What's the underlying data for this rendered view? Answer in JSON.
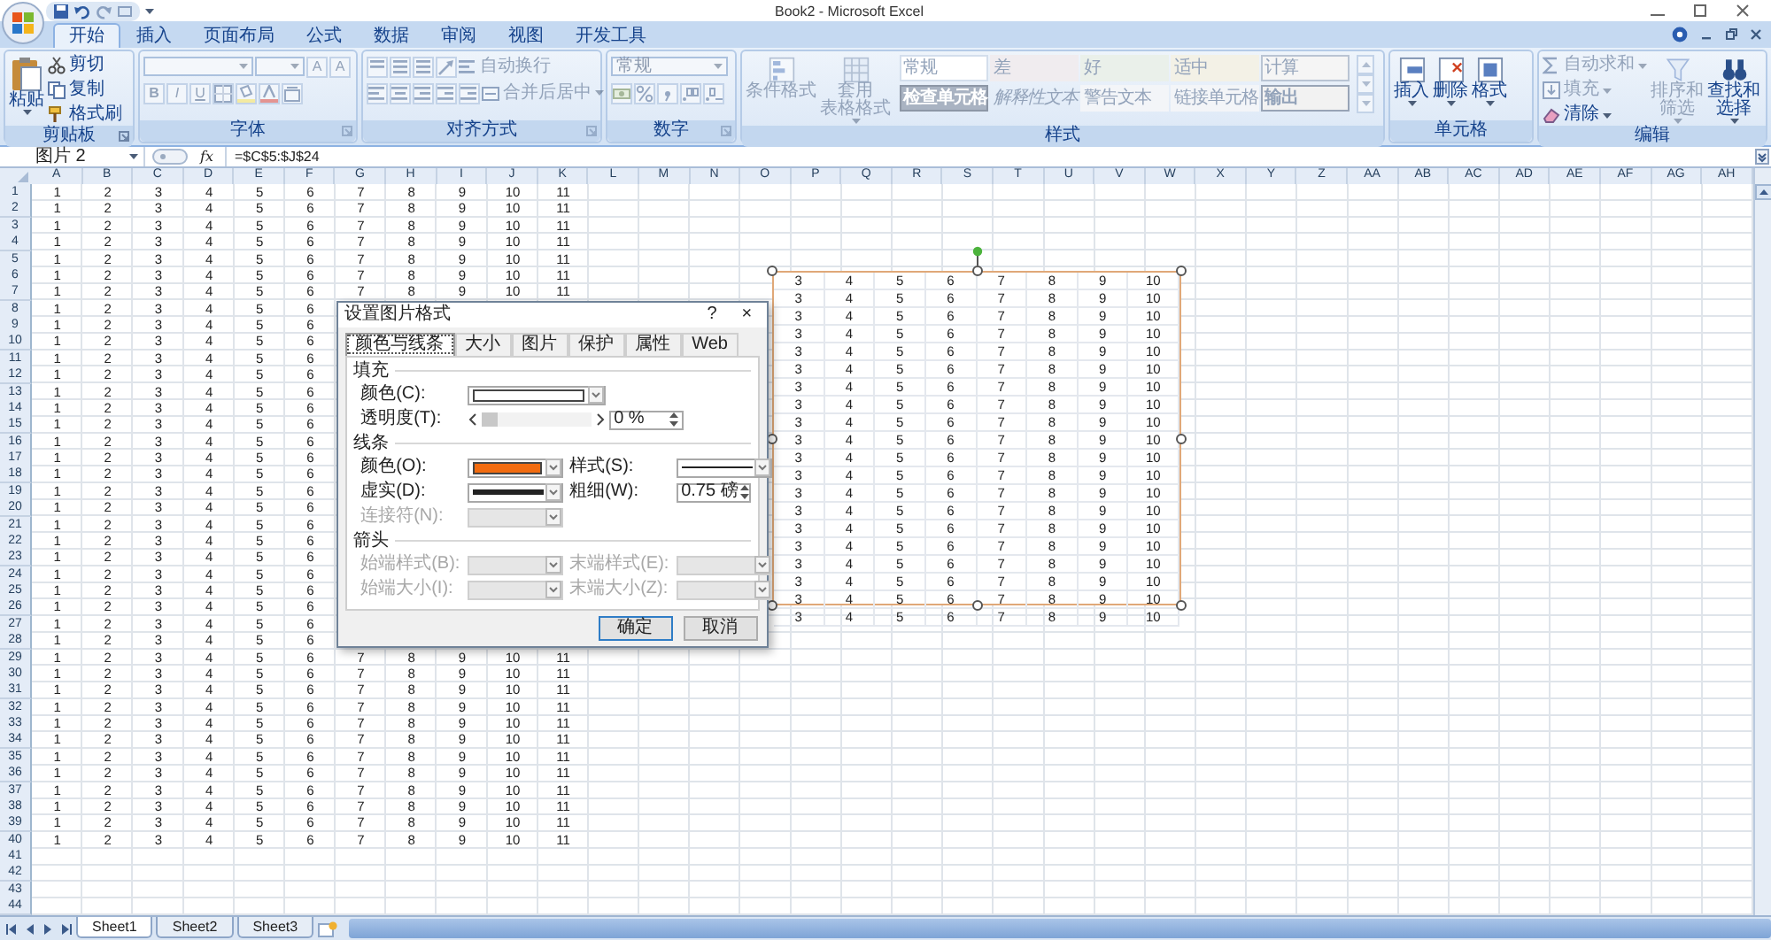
{
  "window": {
    "title": "Book2 - Microsoft Excel"
  },
  "ribbon_tabs": [
    {
      "label": "开始",
      "selected": true
    },
    {
      "label": "插入",
      "selected": false
    },
    {
      "label": "页面布局",
      "selected": false
    },
    {
      "label": "公式",
      "selected": false
    },
    {
      "label": "数据",
      "selected": false
    },
    {
      "label": "审阅",
      "selected": false
    },
    {
      "label": "视图",
      "selected": false
    },
    {
      "label": "开发工具",
      "selected": false
    }
  ],
  "ribbon": {
    "groups": [
      {
        "kind": "clipboard",
        "label": "剪贴板",
        "paste": "粘贴",
        "actions": [
          "剪切",
          "复制",
          "格式刷"
        ]
      },
      {
        "kind": "font",
        "label": "字体",
        "disabled": true,
        "size_buttons": [
          "A",
          "A"
        ],
        "format_buttons": [
          "B",
          "I",
          "U"
        ]
      },
      {
        "kind": "alignment",
        "label": "对齐方式",
        "disabled": true,
        "wrap": "自动换行",
        "merge": "合并后居中"
      },
      {
        "kind": "number",
        "label": "数字",
        "disabled": true,
        "format": "常规"
      },
      {
        "kind": "styles",
        "label": "样式",
        "disabled": true,
        "buttons": [
          {
            "lines": [
              "条件格式"
            ]
          },
          {
            "lines": [
              "套用",
              "表格格式"
            ]
          }
        ],
        "cells": [
          {
            "text": "常规",
            "kind": "normal"
          },
          {
            "text": "差",
            "kind": "bad"
          },
          {
            "text": "好",
            "kind": "good"
          },
          {
            "text": "适中",
            "kind": "neutral"
          },
          {
            "text": "计算",
            "kind": "calc"
          },
          {
            "text": "检查单元格",
            "kind": "check"
          },
          {
            "text": "解释性文本",
            "kind": "explanatory"
          },
          {
            "text": "警告文本",
            "kind": "warning"
          },
          {
            "text": "链接单元格",
            "kind": "linked"
          },
          {
            "text": "输出",
            "kind": "output"
          }
        ]
      },
      {
        "kind": "cells",
        "label": "单元格",
        "buttons": [
          "插入",
          "删除",
          "格式"
        ]
      },
      {
        "kind": "editing",
        "label": "编辑",
        "actions": [
          {
            "label": "自动求和",
            "disabled": true
          },
          {
            "label": "填充",
            "disabled": true
          },
          {
            "label": "清除",
            "disabled": false
          }
        ],
        "buttons": [
          {
            "lines": [
              "排序和",
              "筛选"
            ],
            "disabled": true
          },
          {
            "lines": [
              "查找和",
              "选择"
            ],
            "disabled": false
          }
        ]
      }
    ]
  },
  "formula_bar": {
    "name_box": "图片 2",
    "function_label": "fx",
    "formula": "=$C$5:$J$24"
  },
  "sheet": {
    "columns": [
      "A",
      "B",
      "C",
      "D",
      "E",
      "F",
      "G",
      "H",
      "I",
      "J",
      "K",
      "L",
      "M",
      "N",
      "O",
      "P",
      "Q",
      "R",
      "S",
      "T",
      "U",
      "V",
      "W",
      "X",
      "Y",
      "Z",
      "AA",
      "AB",
      "AC",
      "AD",
      "AE",
      "AF",
      "AG",
      "AH"
    ],
    "rows": [
      {
        "header": "1",
        "cells": [
          "1",
          "2",
          "3",
          "4",
          "5",
          "6",
          "7",
          "8",
          "9",
          "10",
          "11"
        ]
      },
      {
        "header": "2",
        "cells": [
          "1",
          "2",
          "3",
          "4",
          "5",
          "6",
          "7",
          "8",
          "9",
          "10",
          "11"
        ]
      },
      {
        "header": "3",
        "cells": [
          "1",
          "2",
          "3",
          "4",
          "5",
          "6",
          "7",
          "8",
          "9",
          "10",
          "11"
        ]
      },
      {
        "header": "4",
        "cells": [
          "1",
          "2",
          "3",
          "4",
          "5",
          "6",
          "7",
          "8",
          "9",
          "10",
          "11"
        ]
      },
      {
        "header": "5",
        "cells": [
          "1",
          "2",
          "3",
          "4",
          "5",
          "6",
          "7",
          "8",
          "9",
          "10",
          "11"
        ]
      },
      {
        "header": "6",
        "cells": [
          "1",
          "2",
          "3",
          "4",
          "5",
          "6",
          "7",
          "8",
          "9",
          "10",
          "11"
        ]
      },
      {
        "header": "7",
        "cells": [
          "1",
          "2",
          "3",
          "4",
          "5",
          "6",
          "7",
          "8",
          "9",
          "10",
          "11"
        ]
      },
      {
        "header": "8",
        "cells": [
          "1",
          "2",
          "3",
          "4",
          "5",
          "6"
        ]
      },
      {
        "header": "9",
        "cells": [
          "1",
          "2",
          "3",
          "4",
          "5",
          "6"
        ]
      },
      {
        "header": "10",
        "cells": [
          "1",
          "2",
          "3",
          "4",
          "5",
          "6"
        ]
      },
      {
        "header": "11",
        "cells": [
          "1",
          "2",
          "3",
          "4",
          "5",
          "6"
        ]
      },
      {
        "header": "12",
        "cells": [
          "1",
          "2",
          "3",
          "4",
          "5",
          "6"
        ]
      },
      {
        "header": "13",
        "cells": [
          "1",
          "2",
          "3",
          "4",
          "5",
          "6"
        ]
      },
      {
        "header": "14",
        "cells": [
          "1",
          "2",
          "3",
          "4",
          "5",
          "6"
        ]
      },
      {
        "header": "15",
        "cells": [
          "1",
          "2",
          "3",
          "4",
          "5",
          "6"
        ]
      },
      {
        "header": "16",
        "cells": [
          "1",
          "2",
          "3",
          "4",
          "5",
          "6"
        ]
      },
      {
        "header": "17",
        "cells": [
          "1",
          "2",
          "3",
          "4",
          "5",
          "6"
        ]
      },
      {
        "header": "18",
        "cells": [
          "1",
          "2",
          "3",
          "4",
          "5",
          "6"
        ]
      },
      {
        "header": "19",
        "cells": [
          "1",
          "2",
          "3",
          "4",
          "5",
          "6"
        ]
      },
      {
        "header": "20",
        "cells": [
          "1",
          "2",
          "3",
          "4",
          "5",
          "6"
        ]
      },
      {
        "header": "21",
        "cells": [
          "1",
          "2",
          "3",
          "4",
          "5",
          "6"
        ]
      },
      {
        "header": "22",
        "cells": [
          "1",
          "2",
          "3",
          "4",
          "5",
          "6"
        ]
      },
      {
        "header": "23",
        "cells": [
          "1",
          "2",
          "3",
          "4",
          "5",
          "6"
        ]
      },
      {
        "header": "24",
        "cells": [
          "1",
          "2",
          "3",
          "4",
          "5",
          "6"
        ]
      },
      {
        "header": "25",
        "cells": [
          "1",
          "2",
          "3",
          "4",
          "5",
          "6"
        ]
      },
      {
        "header": "26",
        "cells": [
          "1",
          "2",
          "3",
          "4",
          "5",
          "6"
        ]
      },
      {
        "header": "27",
        "cells": [
          "1",
          "2",
          "3",
          "4",
          "5",
          "6"
        ]
      },
      {
        "header": "28",
        "cells": [
          "1",
          "2",
          "3",
          "4",
          "5",
          "6"
        ]
      },
      {
        "header": "29",
        "cells": [
          "1",
          "2",
          "3",
          "4",
          "5",
          "6",
          "7",
          "8",
          "9",
          "10",
          "11"
        ]
      },
      {
        "header": "30",
        "cells": [
          "1",
          "2",
          "3",
          "4",
          "5",
          "6",
          "7",
          "8",
          "9",
          "10",
          "11"
        ]
      },
      {
        "header": "31",
        "cells": [
          "1",
          "2",
          "3",
          "4",
          "5",
          "6",
          "7",
          "8",
          "9",
          "10",
          "11"
        ]
      },
      {
        "header": "32",
        "cells": [
          "1",
          "2",
          "3",
          "4",
          "5",
          "6",
          "7",
          "8",
          "9",
          "10",
          "11"
        ]
      },
      {
        "header": "33",
        "cells": [
          "1",
          "2",
          "3",
          "4",
          "5",
          "6",
          "7",
          "8",
          "9",
          "10",
          "11"
        ]
      },
      {
        "header": "34",
        "cells": [
          "1",
          "2",
          "3",
          "4",
          "5",
          "6",
          "7",
          "8",
          "9",
          "10",
          "11"
        ]
      },
      {
        "header": "35",
        "cells": [
          "1",
          "2",
          "3",
          "4",
          "5",
          "6",
          "7",
          "8",
          "9",
          "10",
          "11"
        ]
      },
      {
        "header": "36",
        "cells": [
          "1",
          "2",
          "3",
          "4",
          "5",
          "6",
          "7",
          "8",
          "9",
          "10",
          "11"
        ]
      },
      {
        "header": "37",
        "cells": [
          "1",
          "2",
          "3",
          "4",
          "5",
          "6",
          "7",
          "8",
          "9",
          "10",
          "11"
        ]
      },
      {
        "header": "38",
        "cells": [
          "1",
          "2",
          "3",
          "4",
          "5",
          "6",
          "7",
          "8",
          "9",
          "10",
          "11"
        ]
      },
      {
        "header": "39",
        "cells": [
          "1",
          "2",
          "3",
          "4",
          "5",
          "6",
          "7",
          "8",
          "9",
          "10",
          "11"
        ]
      },
      {
        "header": "40",
        "cells": [
          "1",
          "2",
          "3",
          "4",
          "5",
          "6",
          "7",
          "8",
          "9",
          "10",
          "11"
        ]
      },
      {
        "header": "41"
      },
      {
        "header": "42"
      },
      {
        "header": "43"
      },
      {
        "header": "44"
      }
    ]
  },
  "linked_picture": {
    "rows": [
      [
        "3",
        "4",
        "5",
        "6",
        "7",
        "8",
        "9",
        "10"
      ],
      [
        "3",
        "4",
        "5",
        "6",
        "7",
        "8",
        "9",
        "10"
      ],
      [
        "3",
        "4",
        "5",
        "6",
        "7",
        "8",
        "9",
        "10"
      ],
      [
        "3",
        "4",
        "5",
        "6",
        "7",
        "8",
        "9",
        "10"
      ],
      [
        "3",
        "4",
        "5",
        "6",
        "7",
        "8",
        "9",
        "10"
      ],
      [
        "3",
        "4",
        "5",
        "6",
        "7",
        "8",
        "9",
        "10"
      ],
      [
        "3",
        "4",
        "5",
        "6",
        "7",
        "8",
        "9",
        "10"
      ],
      [
        "3",
        "4",
        "5",
        "6",
        "7",
        "8",
        "9",
        "10"
      ],
      [
        "3",
        "4",
        "5",
        "6",
        "7",
        "8",
        "9",
        "10"
      ],
      [
        "3",
        "4",
        "5",
        "6",
        "7",
        "8",
        "9",
        "10"
      ],
      [
        "3",
        "4",
        "5",
        "6",
        "7",
        "8",
        "9",
        "10"
      ],
      [
        "3",
        "4",
        "5",
        "6",
        "7",
        "8",
        "9",
        "10"
      ],
      [
        "3",
        "4",
        "5",
        "6",
        "7",
        "8",
        "9",
        "10"
      ],
      [
        "3",
        "4",
        "5",
        "6",
        "7",
        "8",
        "9",
        "10"
      ],
      [
        "3",
        "4",
        "5",
        "6",
        "7",
        "8",
        "9",
        "10"
      ],
      [
        "3",
        "4",
        "5",
        "6",
        "7",
        "8",
        "9",
        "10"
      ],
      [
        "3",
        "4",
        "5",
        "6",
        "7",
        "8",
        "9",
        "10"
      ],
      [
        "3",
        "4",
        "5",
        "6",
        "7",
        "8",
        "9",
        "10"
      ],
      [
        "3",
        "4",
        "5",
        "6",
        "7",
        "8",
        "9",
        "10"
      ],
      [
        "3",
        "4",
        "5",
        "6",
        "7",
        "8",
        "9",
        "10"
      ]
    ]
  },
  "dialog": {
    "title": "设置图片格式",
    "help": "?",
    "close": "×",
    "tabs": [
      {
        "label": "颜色与线条",
        "selected": true
      },
      {
        "label": "大小",
        "selected": false
      },
      {
        "label": "图片",
        "selected": false
      },
      {
        "label": "保护",
        "selected": false
      },
      {
        "label": "属性",
        "selected": false
      },
      {
        "label": "Web",
        "selected": false
      }
    ],
    "sections": [
      {
        "title": "填充",
        "rows": [
          {
            "fields": [
              {
                "kind": "color",
                "label": "颜色(C):",
                "color": "#ffffff",
                "disabled": false
              }
            ]
          },
          {
            "fields": [
              {
                "kind": "slider",
                "label": "透明度(T):",
                "level": 0,
                "value": "0 %",
                "disabled": false
              }
            ]
          }
        ]
      },
      {
        "title": "线条",
        "rows": [
          {
            "fields": [
              {
                "kind": "color",
                "label": "颜色(O):",
                "color": "#f26b0f",
                "disabled": false
              },
              {
                "kind": "line",
                "label": "样式(S):",
                "disabled": false
              }
            ]
          },
          {
            "fields": [
              {
                "kind": "dash",
                "label": "虚实(D):",
                "disabled": false
              },
              {
                "kind": "spin",
                "label": "粗细(W):",
                "value": "0.75 磅",
                "disabled": false
              }
            ]
          },
          {
            "fields": [
              {
                "kind": "combo",
                "label": "连接符(N):",
                "disabled": true
              }
            ]
          }
        ]
      },
      {
        "title": "箭头",
        "rows": [
          {
            "fields": [
              {
                "kind": "combo",
                "label": "始端样式(B):",
                "disabled": true
              },
              {
                "kind": "combo",
                "label": "末端样式(E):",
                "disabled": true
              }
            ]
          },
          {
            "fields": [
              {
                "kind": "combo",
                "label": "始端大小(I):",
                "disabled": true
              },
              {
                "kind": "combo",
                "label": "末端大小(Z):",
                "disabled": true
              }
            ]
          }
        ]
      }
    ],
    "buttons": [
      {
        "label": "确定",
        "default": true
      },
      {
        "label": "取消",
        "default": false
      }
    ]
  },
  "sheet_tabs": [
    {
      "label": "Sheet1",
      "selected": true
    },
    {
      "label": "Sheet2",
      "selected": false
    },
    {
      "label": "Sheet3",
      "selected": false
    }
  ]
}
